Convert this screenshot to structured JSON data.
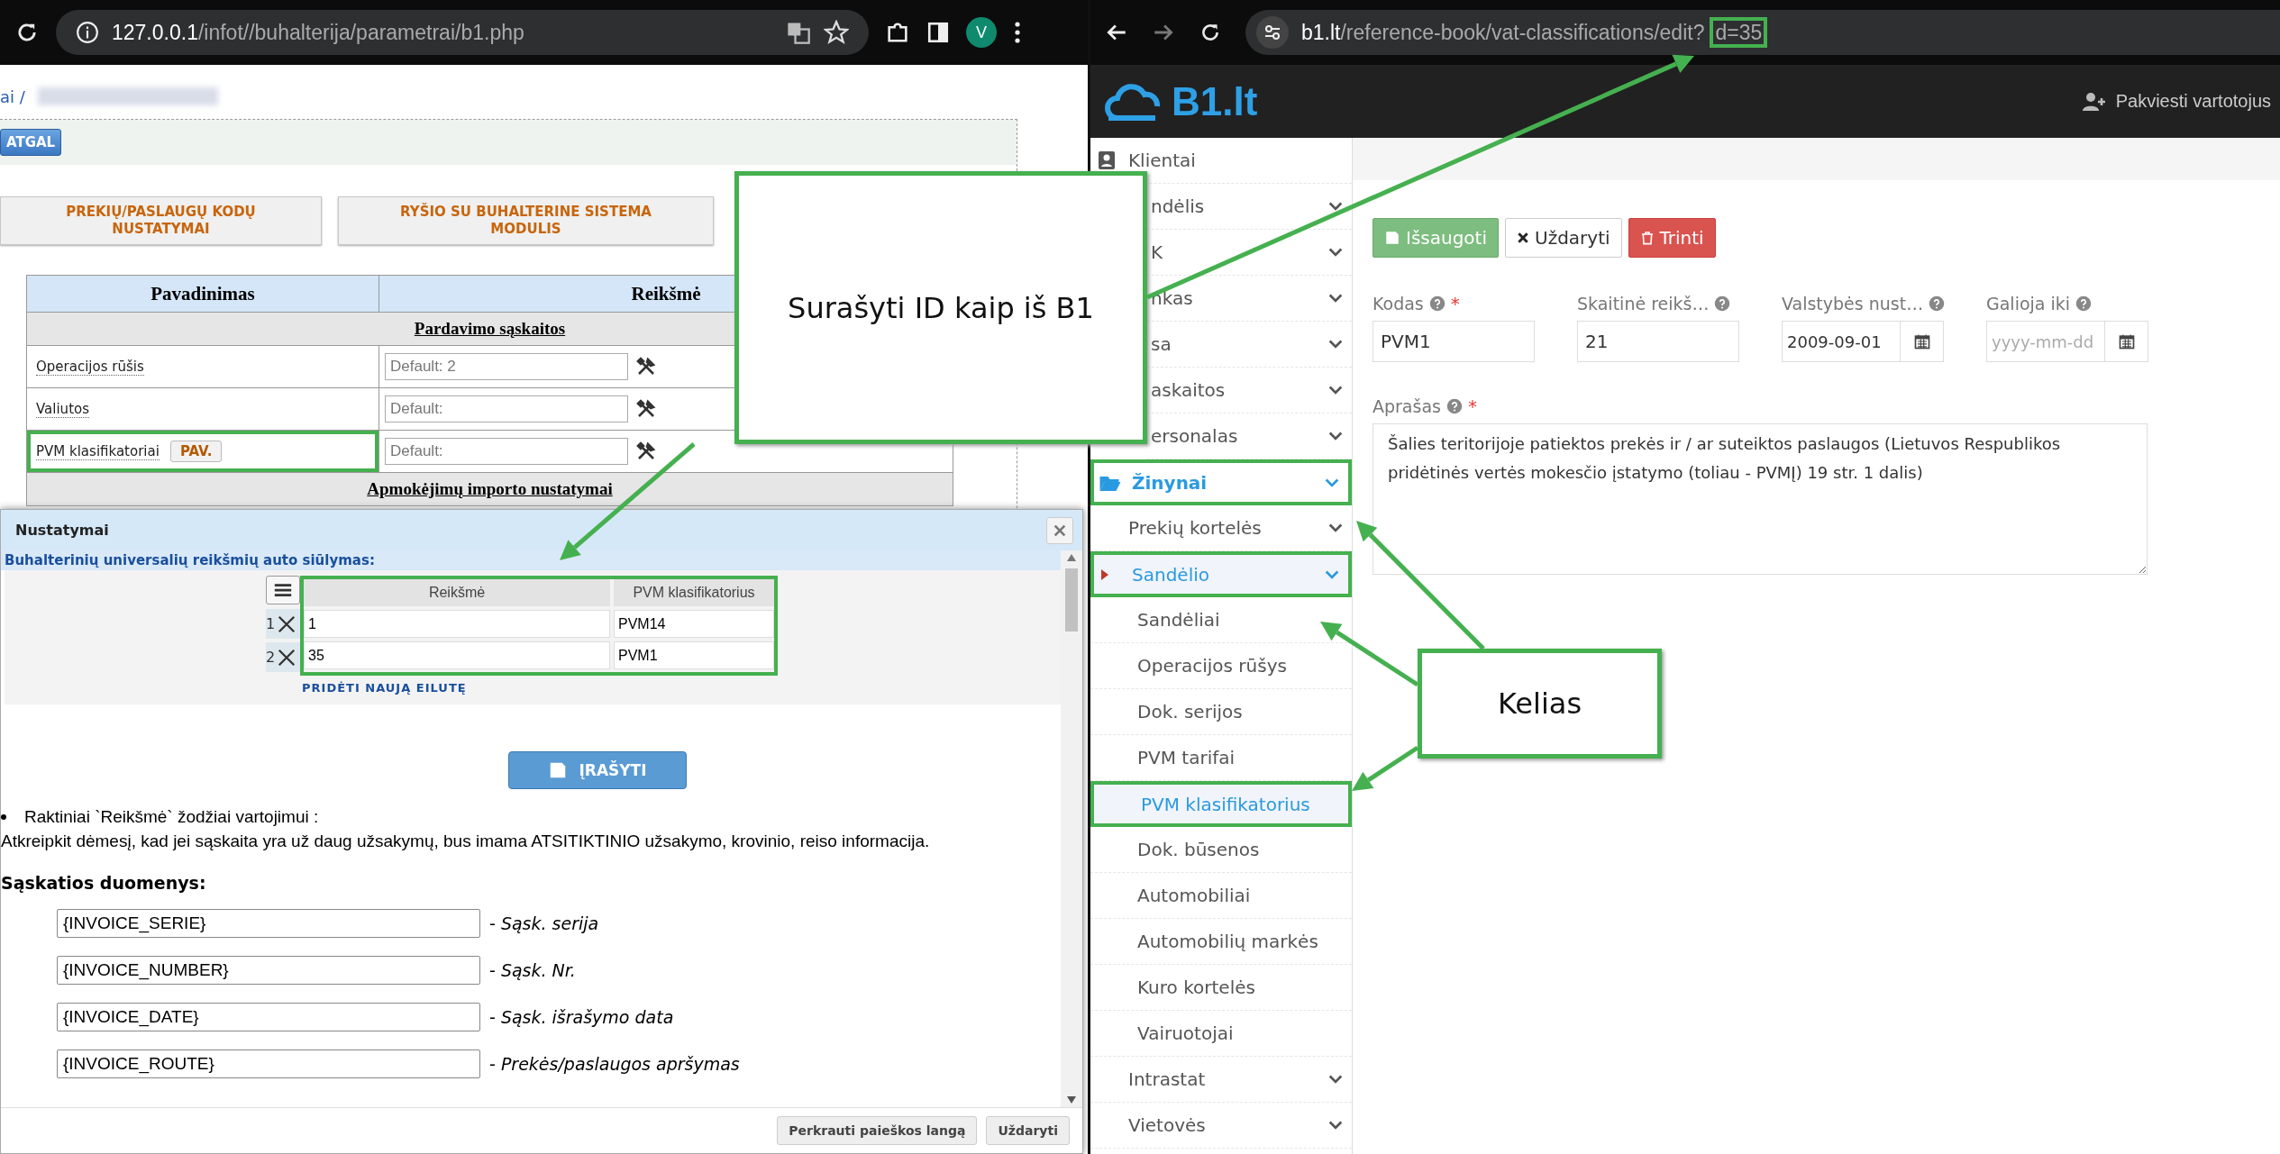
{
  "left_browser": {
    "url_host": "127.0.0.1",
    "url_path": "/infot//buhalterija/parametrai/b1.php",
    "avatar": "V"
  },
  "left_page": {
    "breadcrumb": "ai /",
    "back_button": "ATGAL",
    "module_buttons": [
      "PREKIŲ/PASLAUGŲ KODŲ NUSTATYMAI",
      "RYŠIO SU BUHALTERINE SISTEMA MODULIS"
    ],
    "table": {
      "columns": [
        "Pavadinimas",
        "Reikšmė"
      ],
      "rows": [
        {
          "kind": "section",
          "label": "Pardavimo sąskaitos"
        },
        {
          "kind": "setting",
          "label": "Operacijos rūšis",
          "placeholder": "Default: 2",
          "highlighted": false
        },
        {
          "kind": "setting",
          "label": "Valiutos",
          "placeholder": "Default:",
          "highlighted": false
        },
        {
          "kind": "setting",
          "label": "PVM klasifikatoriai",
          "button": "PAV.",
          "placeholder": "Default:",
          "highlighted": true
        },
        {
          "kind": "section",
          "label": "Apmokėjimų importo nustatymai"
        }
      ]
    }
  },
  "dialog": {
    "title": "Nustatymai",
    "section_title": "Buhalterinių universalių reikšmių auto siūlymas:",
    "grid": {
      "highlighted": true,
      "columns": [
        "Reikšmė",
        "PVM klasifikatorius"
      ],
      "rows": [
        {
          "number": "1",
          "value": "1",
          "code": "PVM14"
        },
        {
          "number": "2",
          "value": "35",
          "code": "PVM1"
        }
      ]
    },
    "add_row_link": "PRIDĖTI NAUJĄ EILUTĘ",
    "save_button": "ĮRAŠYTI",
    "keywords_note": "Raktiniai `Reikšmė` žodžiai vartojimui :",
    "notice": "Atkreipkit dėmesį, kad jei sąskaita yra už daug užsakymų, bus imama ATSITIKTINIO užsakymo, krovinio, reiso informacija.",
    "data_heading": "Sąskatios duomenys:",
    "fields": [
      {
        "value": "{INVOICE_SERIE}",
        "description": "- *Sąsk. serija*"
      },
      {
        "value": "{INVOICE_NUMBER}",
        "description": "- *Sąsk. Nr.*"
      },
      {
        "value": "{INVOICE_DATE}",
        "description": "- *Sąsk. išrašymo data*"
      },
      {
        "value": "{INVOICE_ROUTE}",
        "description": "- *Prekės/paslaugos apršymas*"
      }
    ],
    "footer_buttons": [
      "Perkrauti paieškos langą",
      "Uždaryti"
    ]
  },
  "right_browser": {
    "url_host": "b1.lt",
    "url_path": "/reference-book/vat-classifications/edit?",
    "url_query": "d=35",
    "query_highlighted": true
  },
  "right_page": {
    "logo": "B1.lt",
    "invite": "Pakviesti vartotojus",
    "sidebar": [
      {
        "label": "Klientai",
        "selected": false
      },
      {
        "label": "ndėlis",
        "expanded": false,
        "selected": false
      },
      {
        "label": "K",
        "expanded": false,
        "selected": false
      },
      {
        "label": "nkas",
        "expanded": false,
        "selected": false
      },
      {
        "label": "sa",
        "expanded": false,
        "selected": false
      },
      {
        "label": "askaitos",
        "expanded": false,
        "selected": false
      },
      {
        "label": "ersonalas",
        "expanded": false,
        "selected": false
      },
      {
        "label": "Žinynai",
        "expanded": true,
        "selected": true,
        "highlighted": true,
        "children": [
          {
            "label": "Prekių kortelės",
            "expanded": false,
            "selected": false
          },
          {
            "label": "Sandėlio",
            "expanded": true,
            "selected": true,
            "highlighted": true,
            "children": [
              {
                "label": "Sandėliai",
                "selected": false
              },
              {
                "label": "Operacijos rūšys",
                "selected": false
              },
              {
                "label": "Dok. serijos",
                "selected": false
              },
              {
                "label": "PVM tarifai",
                "selected": false
              },
              {
                "label": "PVM klasifikatorius",
                "selected": true,
                "highlighted": true
              },
              {
                "label": "Dok. būsenos",
                "selected": false
              },
              {
                "label": "Automobiliai",
                "selected": false
              },
              {
                "label": "Automobilių markės",
                "selected": false
              },
              {
                "label": "Kuro kortelės",
                "selected": false
              },
              {
                "label": "Vairuotojai",
                "selected": false
              }
            ]
          },
          {
            "label": "Intrastat",
            "expanded": false,
            "selected": false
          },
          {
            "label": "Vietovės",
            "expanded": false,
            "selected": false
          }
        ]
      }
    ],
    "toolbar": [
      {
        "kind": "save",
        "label": "Išsaugoti"
      },
      {
        "kind": "close",
        "label": "Uždaryti"
      },
      {
        "kind": "delete",
        "label": "Trinti"
      }
    ],
    "fields": [
      {
        "kind": "text",
        "label": "Kodas",
        "required_mark": "*",
        "value": "PVM1"
      },
      {
        "kind": "text",
        "label": "Skaitinė reikš…",
        "value": "21"
      },
      {
        "kind": "date",
        "label": "Valstybės nust…",
        "value": "2009-09-01"
      },
      {
        "kind": "date",
        "label": "Galioja iki",
        "placeholder": "yyyy-mm-dd"
      }
    ],
    "description": {
      "label": "Aprašas",
      "required_mark": "*",
      "value": "Šalies teritorijoje patiektos prekės ir / ar suteiktos paslaugos (Lietuvos Respublikos pridėtinės vertės mokesčio įstatymo (toliau - PVMĮ) 19 str. 1 dalis)"
    }
  },
  "callouts": [
    {
      "text": "Surašyti ID kaip iš B1"
    },
    {
      "text": "Kelias"
    }
  ]
}
